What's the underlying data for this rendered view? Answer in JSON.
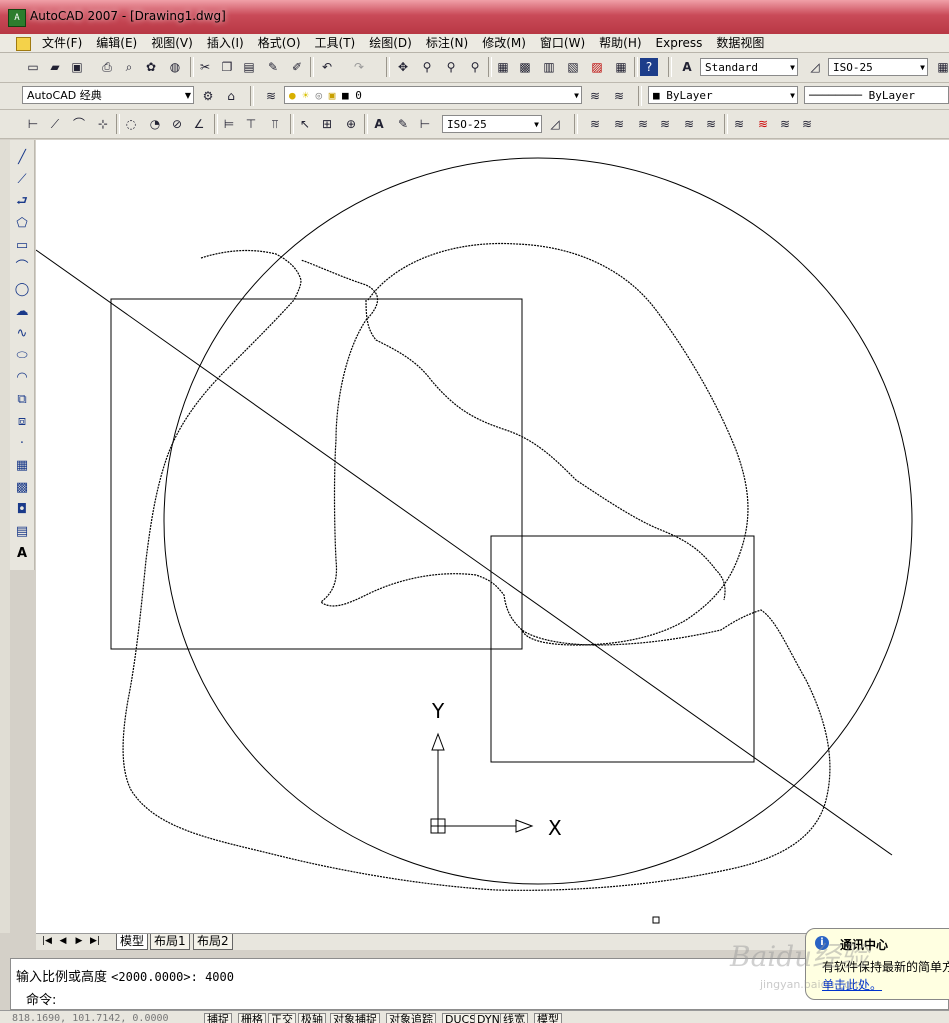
{
  "window": {
    "title": "AutoCAD 2007 - [Drawing1.dwg]",
    "app_icon": "autocad-icon"
  },
  "menubar": {
    "items": [
      "文件(F)",
      "编辑(E)",
      "视图(V)",
      "插入(I)",
      "格式(O)",
      "工具(T)",
      "绘图(D)",
      "标注(N)",
      "修改(M)",
      "窗口(W)",
      "帮助(H)",
      "Express",
      "数据视图"
    ]
  },
  "toolbar_standard": {
    "text_style": "Standard",
    "dim_style": "ISO-25"
  },
  "toolbar_layers": {
    "workspace": "AutoCAD 经典",
    "layer": "0",
    "color": "ByLayer",
    "linetype": "ByLayer"
  },
  "toolbar_dimension": {
    "dim_style": "ISO-25"
  },
  "ucs": {
    "x_label": "X",
    "y_label": "Y"
  },
  "layout_tabs": [
    "模型",
    "布局1",
    "布局2"
  ],
  "command": {
    "prompt_line": "输入比例或高度",
    "prompt_value": "<2000.0000>: 4000",
    "command_label": "命令:"
  },
  "statusbar": {
    "coords": "818.1690, 101.7142, 0.0000",
    "buttons": [
      "捕捉",
      "栅格",
      "正交",
      "极轴",
      "对象捕捉",
      "对象追踪",
      "DUCS",
      "DYN",
      "线宽",
      "模型"
    ]
  },
  "notification": {
    "title": "通讯中心",
    "body": "有软件保持最新的简单方",
    "link": "单击此处。"
  },
  "watermark": {
    "text": "Baidu经验",
    "sub": "jingyan.baidu.com"
  }
}
